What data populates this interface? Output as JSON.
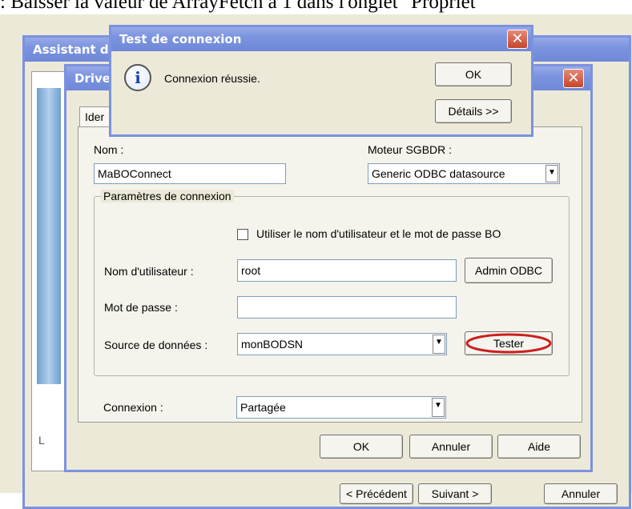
{
  "instruction_text": ": Baisser la valeur de ArrayFetch à 1 dans l'onglet \"Propriét",
  "wizard": {
    "title": "Assistant d",
    "left_label": "L",
    "prev_label": "< Précédent",
    "next_label": "Suivant >",
    "cancel_label": "Annuler"
  },
  "driver_dialog": {
    "title": "Drive",
    "close": "✕",
    "tab_label": "Ider",
    "name_label": "Nom :",
    "name_value": "MaBOConnect",
    "engine_label": "Moteur SGBDR :",
    "engine_value": "Generic ODBC datasource",
    "group_title": "Paramètres de connexion",
    "use_bo_credentials_label": "Utiliser le nom d'utilisateur et le mot de passe BO",
    "user_label": "Nom d'utilisateur :",
    "user_value": "root",
    "admin_odbc_label": "Admin ODBC",
    "password_label": "Mot de passe :",
    "password_value": "",
    "datasource_label": "Source de données :",
    "datasource_value": "monBODSN",
    "test_label": "Tester",
    "connection_label": "Connexion :",
    "connection_value": "Partagée",
    "ok_label": "OK",
    "cancel_label": "Annuler",
    "help_label": "Aide",
    "arrow": "▼"
  },
  "test_dialog": {
    "title": "Test de connexion",
    "close": "✕",
    "icon": "i",
    "message": "Connexion réussie.",
    "ok_label": "OK",
    "details_label": "Détails >>"
  },
  "colors": {
    "title_bar": "#7c94df",
    "highlight_ellipse": "#cc1f1f",
    "window_bg": "#ece9d8"
  }
}
